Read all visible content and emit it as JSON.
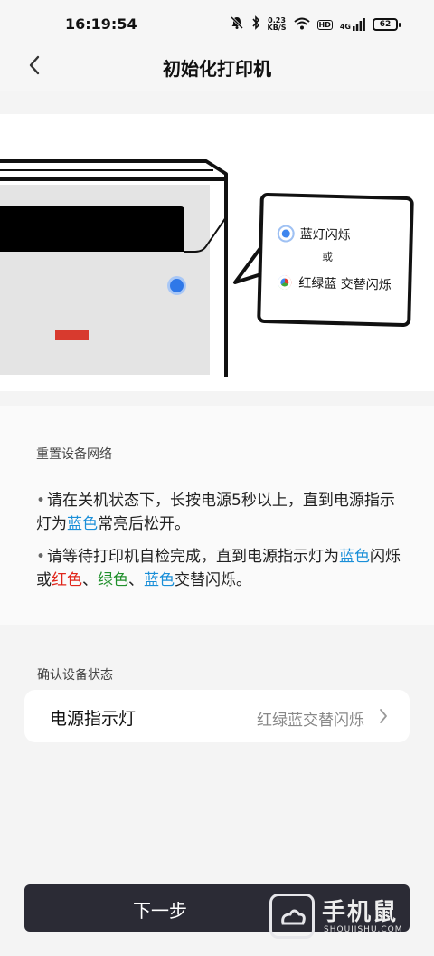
{
  "status_bar": {
    "time": "16:19:54",
    "net_speed_value": "0.23",
    "net_speed_unit": "KB/S",
    "hd_label": "HD",
    "signal_label": "4G",
    "battery": "62",
    "icons": [
      "mute-bell-icon",
      "bluetooth-icon",
      "wifi-icon",
      "signal-icon",
      "battery-icon"
    ]
  },
  "header": {
    "title": "初始化打印机",
    "back_icon": "chevron-left-icon"
  },
  "illustration": {
    "callout": {
      "option1": "蓝灯闪烁",
      "or": "或",
      "option2": "红绿蓝 交替闪烁"
    },
    "colors": {
      "led_blue": "#2f78e8",
      "mark_red": "#d83a2e"
    }
  },
  "reset_section": {
    "title": "重置设备网络",
    "step1": {
      "bullet": "•",
      "part1": "请在关机状态下，长按电源5秒以上，直到电源指示灯为",
      "blue": "蓝色",
      "part2": "常亮后松开。"
    },
    "step2": {
      "bullet": "•",
      "part1": "请等待打印机自检完成，直到电源指示灯为",
      "blue": "蓝色",
      "part2": "闪烁或",
      "red": "红色",
      "sep1": "、",
      "green": "绿色",
      "sep2": "、",
      "blue2": "蓝色",
      "part3": "交替闪烁。"
    },
    "accent_colors": {
      "blue": "#1a8fd8",
      "red": "#e0251b",
      "green": "#1f8f2b"
    }
  },
  "confirm_section": {
    "title": "确认设备状态",
    "row": {
      "label": "电源指示灯",
      "value": "红绿蓝交替闪烁"
    }
  },
  "next_button": {
    "label": "下一步"
  },
  "watermark": {
    "title": "手机鼠",
    "subtitle": "SHOUJISHU.COM"
  }
}
